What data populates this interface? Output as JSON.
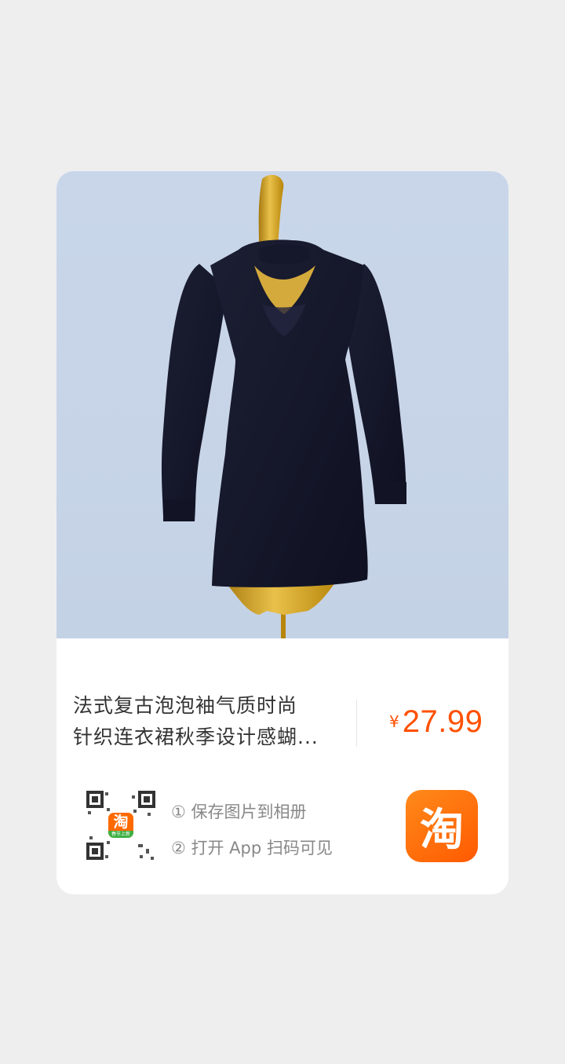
{
  "product": {
    "title_line1": "法式复古泡泡袖气质时尚",
    "title_line2": "针织连衣裙秋季设计感蝴...",
    "currency": "¥",
    "price": "27.99"
  },
  "qr": {
    "logo_char": "淘",
    "logo_tag": "春节上新"
  },
  "steps": {
    "step1": "① 保存图片到相册",
    "step2": "② 打开 App 扫码可见"
  },
  "brand": {
    "logo_char": "淘",
    "logo_icon": "taobao-icon"
  },
  "colors": {
    "accent": "#ff5000",
    "brand_orange": "#ff6a00",
    "page_bg": "#eeeeef"
  }
}
